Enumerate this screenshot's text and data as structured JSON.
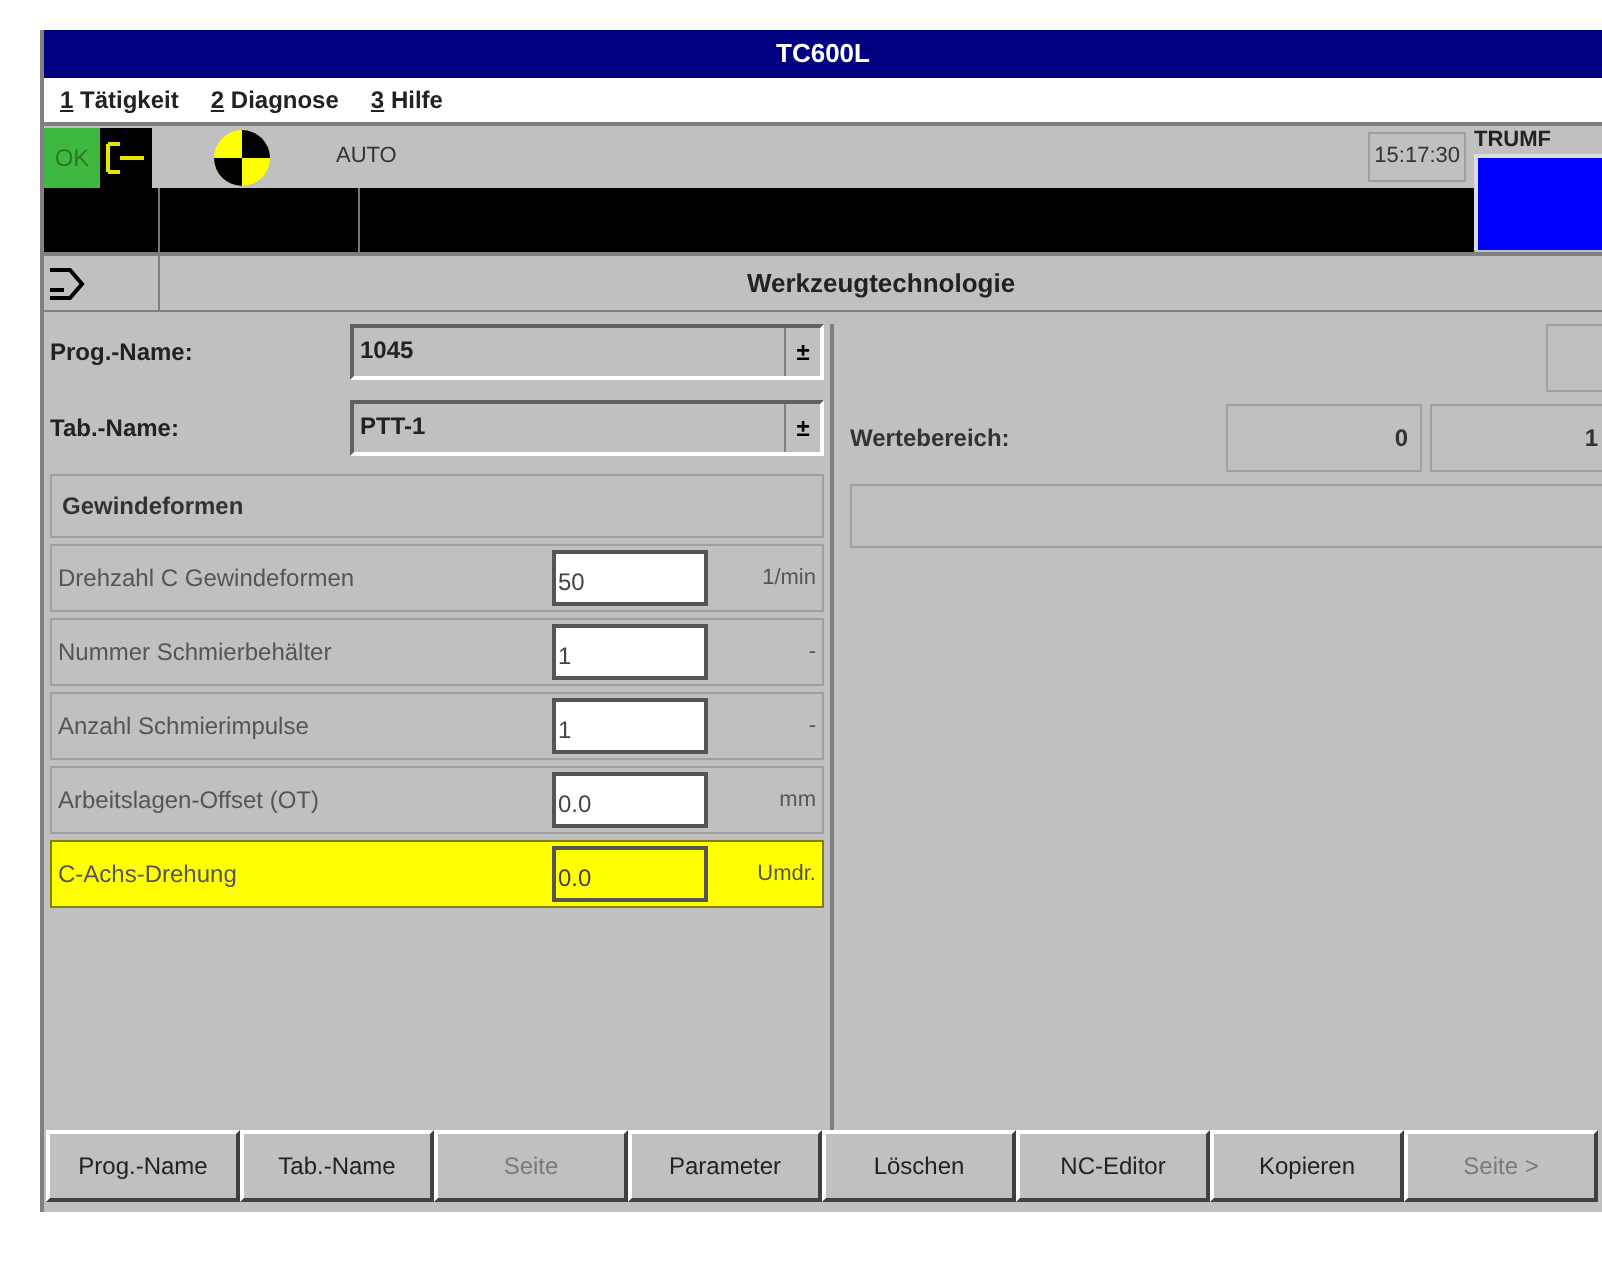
{
  "window": {
    "title": "TC600L"
  },
  "menu": [
    "1 Tätigkeit",
    "2 Diagnose",
    "3 Hilfe"
  ],
  "status": {
    "ok": "OK",
    "mode": "AUTO",
    "time": "15:17:30",
    "brand": "TRUMF"
  },
  "header": {
    "title": "Werkzeugtechnologie"
  },
  "selectors": [
    {
      "label": "Prog.-Name:",
      "value": "1045",
      "arrow": "±"
    },
    {
      "label": "Tab.-Name:",
      "value": "PTT-1",
      "arrow": "±"
    }
  ],
  "range": {
    "label": "Wertebereich:",
    "min": "0",
    "max": "1"
  },
  "group": {
    "title": "Gewindeformen"
  },
  "params": [
    {
      "label": "Drehzahl C Gewindeformen",
      "value": "50",
      "unit": "1/min",
      "selected": false
    },
    {
      "label": "Nummer Schmierbehälter",
      "value": "1",
      "unit": "-",
      "selected": false
    },
    {
      "label": "Anzahl Schmierimpulse",
      "value": "1",
      "unit": "-",
      "selected": false
    },
    {
      "label": "Arbeitslagen-Offset (OT)",
      "value": "0.0",
      "unit": "mm",
      "selected": false
    },
    {
      "label": "C-Achs-Drehung",
      "value": "0.0",
      "unit": "Umdr.",
      "selected": true
    }
  ],
  "softkeys": [
    {
      "label": "Prog.-Name",
      "disabled": false
    },
    {
      "label": "Tab.-Name",
      "disabled": false
    },
    {
      "label": "Seite",
      "disabled": true
    },
    {
      "label": "Parameter",
      "disabled": false
    },
    {
      "label": "Löschen",
      "disabled": false
    },
    {
      "label": "NC-Editor",
      "disabled": false
    },
    {
      "label": "Kopieren",
      "disabled": false
    },
    {
      "label": "Seite >",
      "disabled": true
    }
  ]
}
